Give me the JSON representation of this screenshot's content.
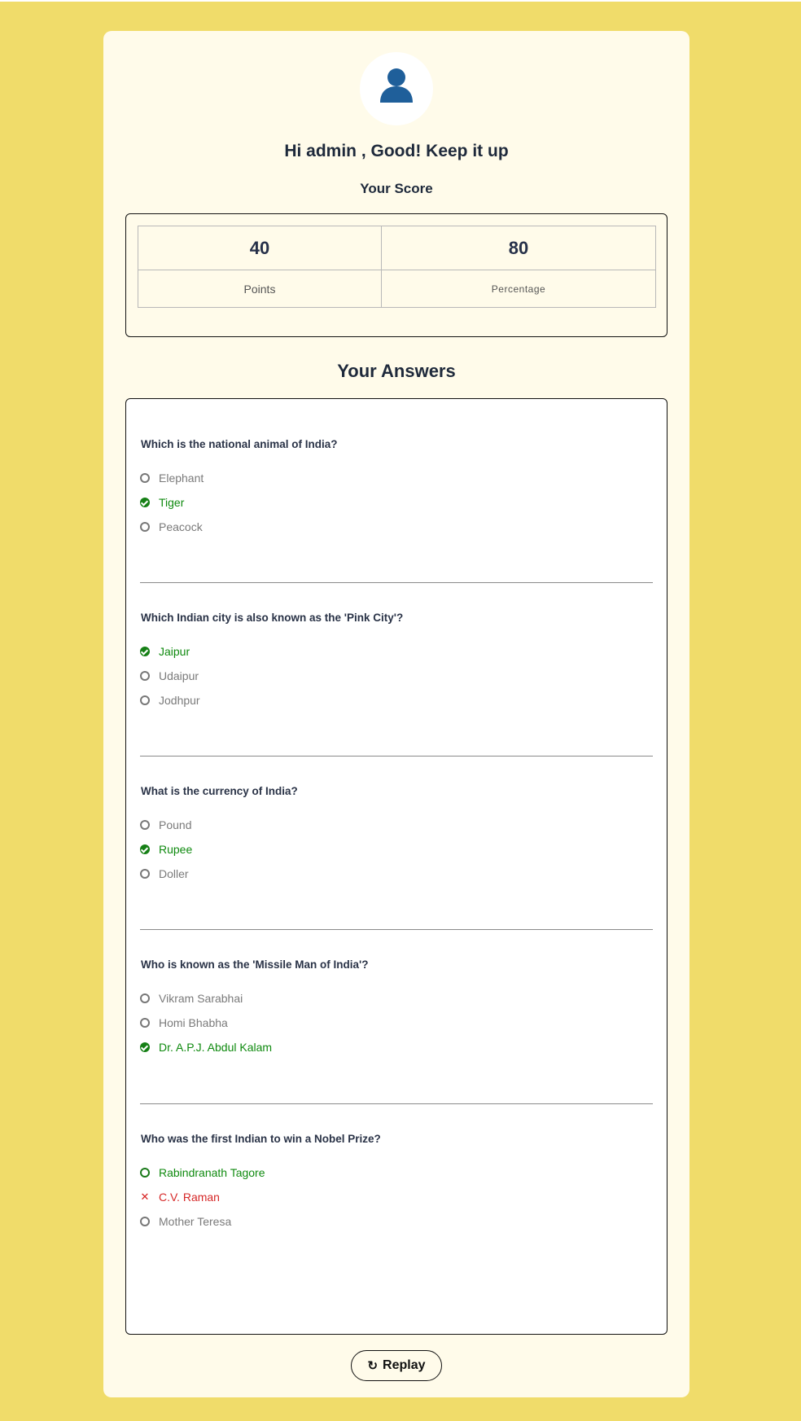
{
  "header": {
    "avatar_icon": "user-icon",
    "greeting": "Hi admin , Good! Keep it up",
    "score_title": "Your Score"
  },
  "score": {
    "points_value": "40",
    "points_label": "Points",
    "percentage_value": "80",
    "percentage_label": "Percentage"
  },
  "answers": {
    "title": "Your Answers",
    "questions": [
      {
        "text": "Which is the national animal of India?",
        "options": [
          {
            "label": "Elephant",
            "state": "neutral"
          },
          {
            "label": "Tiger",
            "state": "correct-selected"
          },
          {
            "label": "Peacock",
            "state": "neutral"
          }
        ]
      },
      {
        "text": "Which Indian city is also known as the 'Pink City'?",
        "options": [
          {
            "label": "Jaipur",
            "state": "correct-selected"
          },
          {
            "label": "Udaipur",
            "state": "neutral"
          },
          {
            "label": "Jodhpur",
            "state": "neutral"
          }
        ]
      },
      {
        "text": "What is the currency of India?",
        "options": [
          {
            "label": "Pound",
            "state": "neutral"
          },
          {
            "label": "Rupee",
            "state": "correct-selected"
          },
          {
            "label": "Doller",
            "state": "neutral"
          }
        ]
      },
      {
        "text": "Who is known as the 'Missile Man of India'?",
        "options": [
          {
            "label": "Vikram Sarabhai",
            "state": "neutral"
          },
          {
            "label": "Homi Bhabha",
            "state": "neutral"
          },
          {
            "label": "Dr. A.P.J. Abdul Kalam",
            "state": "correct-selected"
          }
        ]
      },
      {
        "text": "Who was the first Indian to win a Nobel Prize?",
        "options": [
          {
            "label": "Rabindranath Tagore",
            "state": "correct-unselected"
          },
          {
            "label": "C.V. Raman",
            "state": "wrong-selected"
          },
          {
            "label": "Mother Teresa",
            "state": "neutral"
          }
        ]
      }
    ]
  },
  "footer": {
    "replay_label": "Replay",
    "replay_icon": "refresh-icon"
  },
  "colors": {
    "page_background": "#f0dc6a",
    "card_background": "#fffbea",
    "avatar_icon": "#1f5f9a",
    "correct": "#0f8a0f",
    "wrong": "#d62828",
    "neutral": "#7a7a7a"
  }
}
